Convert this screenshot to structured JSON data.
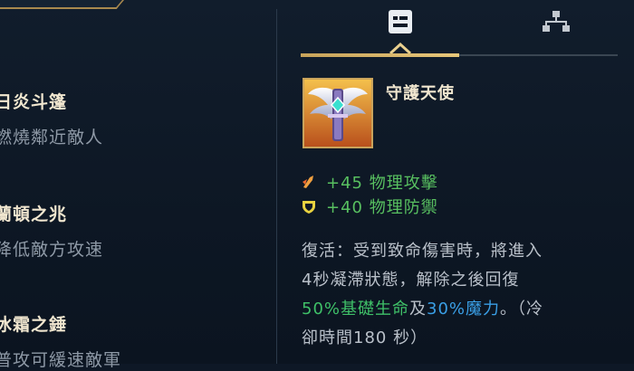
{
  "left_items": [
    {
      "name": "日炎斗篷",
      "desc": "燃燒鄰近敵人"
    },
    {
      "name": "蘭頓之兆",
      "desc": "降低敵方攻速"
    },
    {
      "name": "冰霜之錘",
      "desc": "普攻可緩速敵軍"
    }
  ],
  "tabs": {
    "detail_icon": "item-detail-icon",
    "tree_icon": "build-tree-icon"
  },
  "item": {
    "name": "守護天使",
    "icon": "guardian-angel-icon",
    "stats": [
      {
        "icon": "attack-damage-icon",
        "text": "+45 物理攻擊",
        "color": "#58c060"
      },
      {
        "icon": "armor-icon",
        "text": "+40 物理防禦",
        "color": "#58c060"
      }
    ],
    "passive": {
      "line1": "復活：受到致命傷害時，將進入",
      "line2": "4秒凝滯狀態，解除之後回復",
      "health_pct": "50%基礎生命",
      "and": "及",
      "mana_pct": "30%魔力",
      "cooldown_prefix": "。（冷",
      "cooldown_suffix": "卻時間180 秒）"
    }
  },
  "colors": {
    "accent_gold": "#c9a35b",
    "health_green": "#3fc068",
    "mana_blue": "#3a9fe6",
    "stat_green": "#58c060"
  }
}
